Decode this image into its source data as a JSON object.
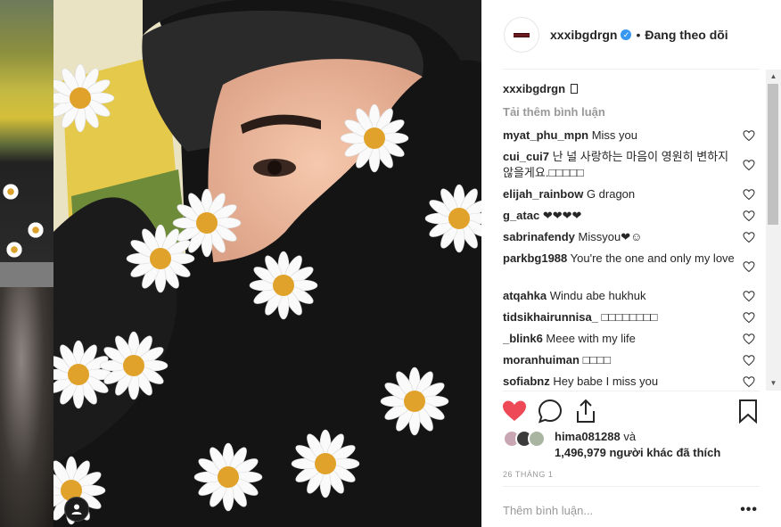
{
  "header": {
    "username": "xxxibgdrgn",
    "separator": "•",
    "follow_status": "Đang theo dõi"
  },
  "caption": {
    "username": "xxxibgdrgn"
  },
  "load_more": "Tải thêm bình luận",
  "comments": [
    {
      "user": "myat_phu_mpn",
      "text": "Miss you"
    },
    {
      "user": "cui_cui7",
      "text": "난 널 사랑하는 마음이 영원히 변하지 않을게요.□□□□□"
    },
    {
      "user": "elijah_rainbow",
      "text": "G dragon"
    },
    {
      "user": "g_atac",
      "text": "❤❤❤❤"
    },
    {
      "user": "sabrinafendy",
      "text": "Missyou❤☺"
    },
    {
      "user": "parkbg1988",
      "text": "You're the one and only my love"
    },
    {
      "user": "atqahka",
      "text": "Windu abe hukhuk"
    },
    {
      "user": "tidsikhairunnisa_",
      "text": "□□□□□□□□"
    },
    {
      "user": "_blink6",
      "text": "Meee with my life"
    },
    {
      "user": "moranhuiman",
      "text": "□□□□"
    },
    {
      "user": "sofiabnz",
      "text": "Hey babe I miss you"
    }
  ],
  "likes": {
    "first_user": "hima081288",
    "conj": "và",
    "count": "1,496,979",
    "rest": "người khác đã thích"
  },
  "date": "26 THÁNG 1",
  "add_comment_placeholder": "Thêm bình luận...",
  "more_options": "•••",
  "colors": {
    "heart_liked": "#ed4956",
    "verified": "#3897f0",
    "link_gray": "#999999"
  },
  "icons": [
    "heart-icon",
    "comment-icon",
    "share-icon",
    "bookmark-icon",
    "verified-icon",
    "user-tag-icon"
  ]
}
